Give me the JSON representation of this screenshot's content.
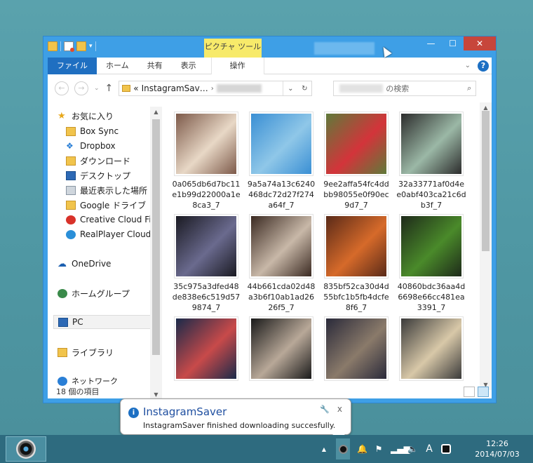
{
  "window": {
    "context_tab": "ピクチャ ツール",
    "minimize": "—",
    "maximize": "☐",
    "close": "✕"
  },
  "ribbon": {
    "tabs": [
      "ファイル",
      "ホーム",
      "共有",
      "表示"
    ],
    "context_sub_tab": "操作",
    "expand": "⌄",
    "help": "?"
  },
  "nav": {
    "back": "←",
    "forward": "→",
    "dropdown": "⌄",
    "up": "↑",
    "address_prefix": "«",
    "address_folder": "InstagramSav…",
    "address_sep": "›",
    "refresh": "↻",
    "search_placeholder": "の検索"
  },
  "sidebar": {
    "favorites": "お気に入り",
    "items": [
      {
        "label": "Box Sync",
        "icon": "folder-icon"
      },
      {
        "label": "Dropbox",
        "icon": "dropbox-icon"
      },
      {
        "label": "ダウンロード",
        "icon": "folder-icon"
      },
      {
        "label": "デスクトップ",
        "icon": "desktop-icon"
      },
      {
        "label": "最近表示した場所",
        "icon": "recent-places-icon"
      },
      {
        "label": "Google ドライブ",
        "icon": "folder-icon"
      },
      {
        "label": "Creative Cloud Fi",
        "icon": "creative-cloud-icon"
      },
      {
        "label": "RealPlayer Cloud",
        "icon": "realplayer-icon"
      }
    ],
    "onedrive": "OneDrive",
    "homegroup": "ホームグループ",
    "pc": "PC",
    "libraries": "ライブラリ",
    "network": "ネットワーク"
  },
  "files": [
    {
      "name": "0a065db6d7bc11e1b99d22000a1e8ca3_7",
      "c1": "#7d5a4a",
      "c2": "#e8d8c6"
    },
    {
      "name": "9a5a74a13c6240468dc72d27f274a64f_7",
      "c1": "#3a8fd4",
      "c2": "#8fc7e8"
    },
    {
      "name": "9ee2affa54fc4ddbb98055e0f90ec9d7_7",
      "c1": "#5f7a3a",
      "c2": "#d3343a"
    },
    {
      "name": "32a33771af0d4ee0abf403ca21c6db3f_7",
      "c1": "#2c2c2c",
      "c2": "#9bb8a6"
    },
    {
      "name": "35c975a3dfed48de838e6c519d579874_7",
      "c1": "#1a1a22",
      "c2": "#6a6a8e"
    },
    {
      "name": "44b661cda02d48a3b6f10ab1ad2626f5_7",
      "c1": "#3b2a22",
      "c2": "#c8b8a8"
    },
    {
      "name": "835bf52ca30d4d55bfc1b5fb4dcfe8f6_7",
      "c1": "#5a2a18",
      "c2": "#d66a2a"
    },
    {
      "name": "40860bdc36aa4d6698e66cc481ea3391_7",
      "c1": "#1e2a1a",
      "c2": "#4a8a2a"
    },
    {
      "name": "",
      "c1": "#1a2a4a",
      "c2": "#c84a4a"
    },
    {
      "name": "",
      "c1": "#1a1a1a",
      "c2": "#b8a898"
    },
    {
      "name": "",
      "c1": "#2a2a3a",
      "c2": "#8a7a6a"
    },
    {
      "name": "",
      "c1": "#3a3a3a",
      "c2": "#d8c8a8"
    }
  ],
  "status": {
    "item_count": "18 個の項目"
  },
  "notification": {
    "title": "InstagramSaver",
    "message": "InstagramSaver finished downloading succesfully.",
    "close": "x"
  },
  "taskbar": {
    "tray_expand": "▲",
    "ime": "A",
    "time": "12:26",
    "date": "2014/07/03"
  }
}
